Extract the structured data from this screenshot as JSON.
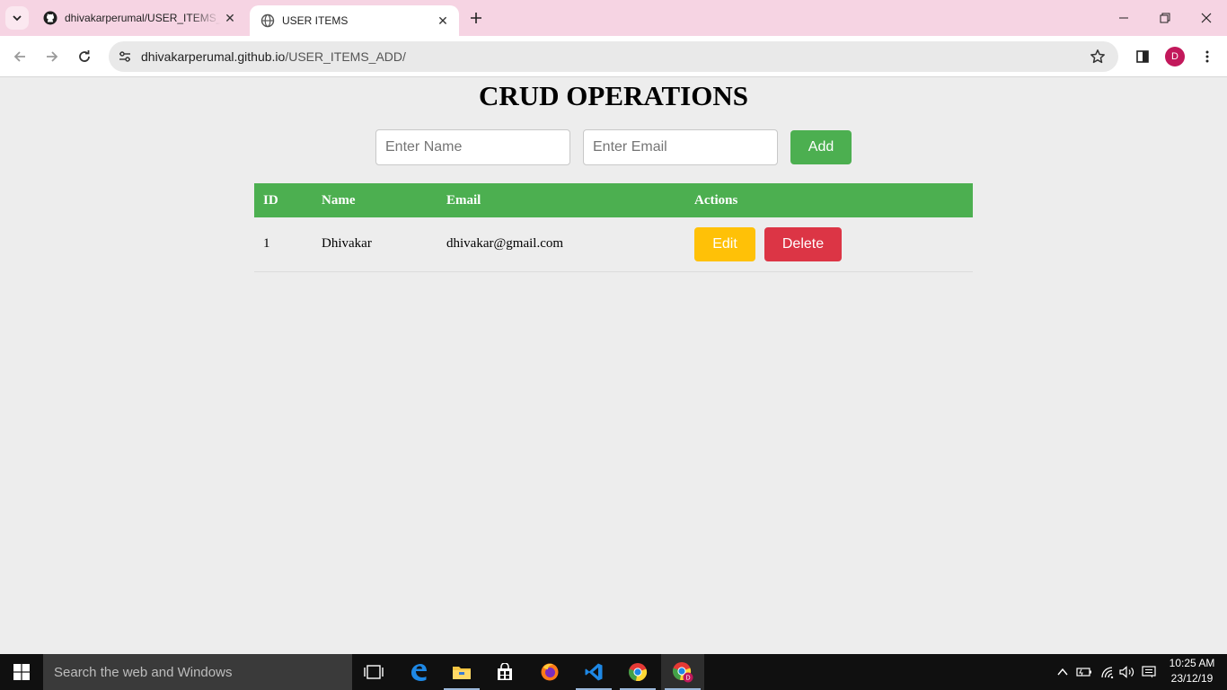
{
  "browser": {
    "tabs": [
      {
        "title": "dhivakarperumal/USER_ITEMS_ADD",
        "favicon": "github-icon",
        "active": false
      },
      {
        "title": "USER ITEMS",
        "favicon": "globe-icon",
        "active": true
      }
    ],
    "address": {
      "host": "dhivakarperumal.github.io",
      "path": "/USER_ITEMS_ADD/"
    },
    "profile_initial": "D",
    "colors": {
      "tabstrip": "#f6d4e3",
      "profile": "#c2185b"
    }
  },
  "page": {
    "heading": "CRUD OPERATIONS",
    "form": {
      "name_placeholder": "Enter Name",
      "email_placeholder": "Enter Email",
      "add_label": "Add"
    },
    "table": {
      "columns": [
        "ID",
        "Name",
        "Email",
        "Actions"
      ],
      "rows": [
        {
          "id": "1",
          "name": "Dhivakar",
          "email": "dhivakar@gmail.com",
          "edit_label": "Edit",
          "delete_label": "Delete"
        }
      ]
    },
    "colors": {
      "primary": "#4caf50",
      "edit": "#ffc107",
      "delete": "#dc3545"
    }
  },
  "taskbar": {
    "search_placeholder": "Search the web and Windows",
    "pinned": [
      "task-view-icon",
      "edge-icon",
      "file-explorer-icon",
      "store-icon",
      "firefox-icon",
      "vscode-icon",
      "chrome-icon",
      "chrome-profile-icon"
    ],
    "time": "10:25 AM",
    "date": "23/12/19"
  }
}
